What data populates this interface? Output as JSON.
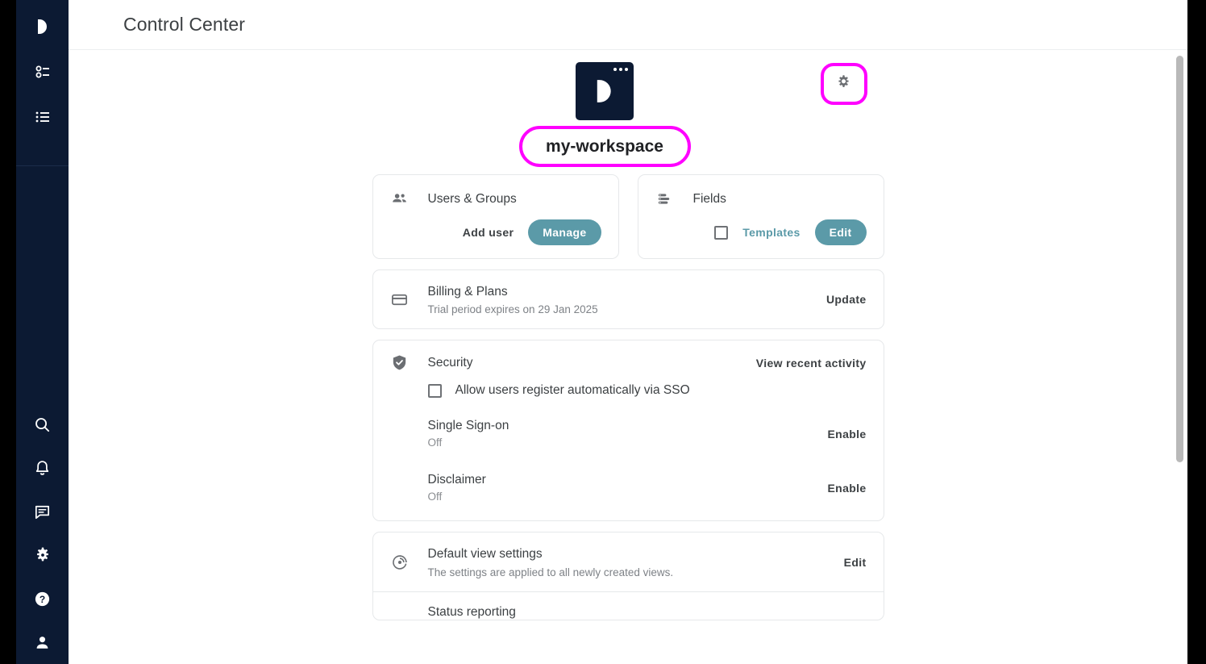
{
  "colors": {
    "rail_bg": "#0c1a33",
    "accent_teal": "#5b9aa8",
    "highlight_magenta": "#ff00ff",
    "text_primary": "#3c4043",
    "text_muted": "#7e8287"
  },
  "sidebar": {
    "top_items": [
      {
        "icon": "app-logo-icon",
        "label": "Workspace logo"
      },
      {
        "icon": "filters-icon",
        "label": "Filters"
      },
      {
        "icon": "list-icon",
        "label": "List"
      }
    ],
    "bottom_items": [
      {
        "icon": "search-icon",
        "label": "Search"
      },
      {
        "icon": "bell-icon",
        "label": "Notifications"
      },
      {
        "icon": "chat-icon",
        "label": "Messages"
      },
      {
        "icon": "gear-icon",
        "label": "Settings"
      },
      {
        "icon": "help-icon",
        "label": "Help"
      },
      {
        "icon": "person-icon",
        "label": "Account"
      }
    ]
  },
  "header": {
    "title": "Control Center"
  },
  "workspace": {
    "logo_icon": "workspace-logo-icon",
    "settings_icon": "gear-icon",
    "name": "my-workspace"
  },
  "cards": {
    "users_groups": {
      "icon": "people-icon",
      "title": "Users & Groups",
      "add_user_label": "Add user",
      "manage_label": "Manage"
    },
    "fields": {
      "icon": "fields-icon",
      "title": "Fields",
      "templates_label": "Templates",
      "templates_checked": false,
      "edit_label": "Edit"
    },
    "billing": {
      "icon": "credit-card-icon",
      "title": "Billing & Plans",
      "subtitle": "Trial period expires on 29 Jan 2025",
      "action_label": "Update"
    },
    "security": {
      "icon": "shield-check-icon",
      "title": "Security",
      "view_activity_label": "View recent activity",
      "sso_register_label": "Allow users register automatically via SSO",
      "sso_register_checked": false,
      "items": [
        {
          "title": "Single Sign-on",
          "state": "Off",
          "action_label": "Enable"
        },
        {
          "title": "Disclaimer",
          "state": "Off",
          "action_label": "Enable"
        }
      ]
    },
    "default_view": {
      "icon": "radar-icon",
      "title": "Default view settings",
      "subtitle": "The settings are applied to all newly created views.",
      "action_label": "Edit"
    },
    "status_reporting": {
      "title": "Status reporting"
    }
  }
}
